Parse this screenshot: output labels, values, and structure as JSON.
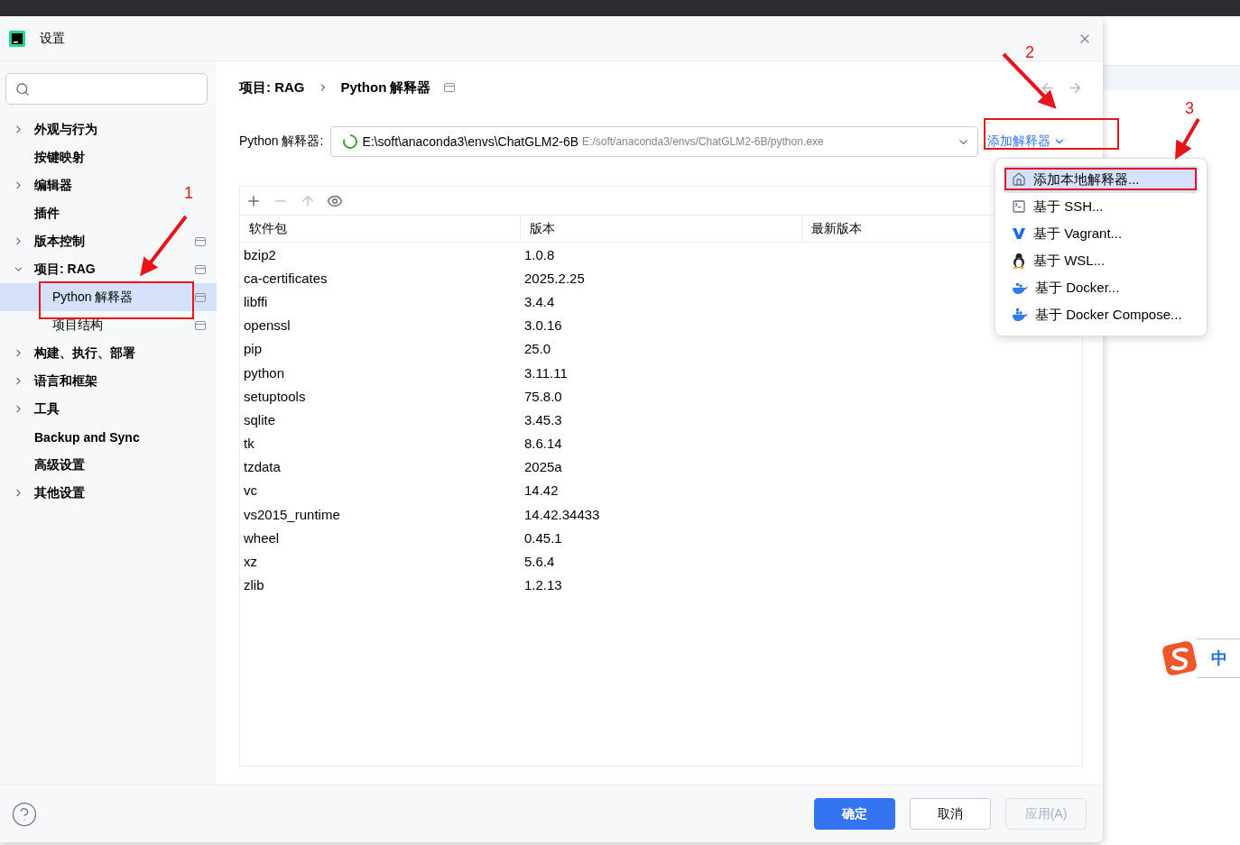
{
  "dialog": {
    "title": "设置"
  },
  "sidebar": {
    "items": [
      {
        "label": "外观与行为",
        "expanded": false,
        "selected": false
      },
      {
        "label": "按键映射",
        "selected": false
      },
      {
        "label": "编辑器",
        "expanded": false,
        "selected": false
      },
      {
        "label": "插件",
        "selected": false
      },
      {
        "label": "版本控制",
        "expanded": false,
        "selected": false,
        "scoped": true
      },
      {
        "label": "项目: RAG",
        "expanded": true,
        "selected": false,
        "scoped": true,
        "children": [
          {
            "label": "Python 解释器",
            "selected": true,
            "scoped": true
          },
          {
            "label": "项目结构",
            "selected": false,
            "scoped": true
          }
        ]
      },
      {
        "label": "构建、执行、部署",
        "expanded": false,
        "selected": false
      },
      {
        "label": "语言和框架",
        "expanded": false,
        "selected": false
      },
      {
        "label": "工具",
        "expanded": false,
        "selected": false
      },
      {
        "label": "Backup and Sync",
        "selected": false
      },
      {
        "label": "高级设置",
        "selected": false
      },
      {
        "label": "其他设置",
        "expanded": false,
        "selected": false
      }
    ]
  },
  "breadcrumb": [
    "项目: RAG",
    "Python 解释器"
  ],
  "interpreter": {
    "label": "Python 解释器:",
    "name": "E:\\soft\\anaconda3\\envs\\ChatGLM2-6B",
    "path": "E:/soft/anaconda3/envs/ChatGLM2-6B/python.exe",
    "add_link": "添加解释器"
  },
  "table": {
    "columns": [
      "软件包",
      "版本",
      "最新版本"
    ],
    "rows": [
      [
        "bzip2",
        "1.0.8",
        ""
      ],
      [
        "ca-certificates",
        "2025.2.25",
        ""
      ],
      [
        "libffi",
        "3.4.4",
        ""
      ],
      [
        "openssl",
        "3.0.16",
        ""
      ],
      [
        "pip",
        "25.0",
        ""
      ],
      [
        "python",
        "3.11.11",
        ""
      ],
      [
        "setuptools",
        "75.8.0",
        ""
      ],
      [
        "sqlite",
        "3.45.3",
        ""
      ],
      [
        "tk",
        "8.6.14",
        ""
      ],
      [
        "tzdata",
        "2025a",
        ""
      ],
      [
        "vc",
        "14.42",
        ""
      ],
      [
        "vs2015_runtime",
        "14.42.34433",
        ""
      ],
      [
        "wheel",
        "0.45.1",
        ""
      ],
      [
        "xz",
        "5.6.4",
        ""
      ],
      [
        "zlib",
        "1.2.13",
        ""
      ]
    ]
  },
  "add_menu": [
    {
      "kind": "home",
      "label": "添加本地解释器...",
      "selected": true
    },
    {
      "kind": "terminal",
      "label": "基于 SSH...",
      "selected": false
    },
    {
      "kind": "vagrant",
      "label": "基于 Vagrant...",
      "selected": false
    },
    {
      "kind": "linux",
      "label": "基于 WSL...",
      "selected": false
    },
    {
      "kind": "docker",
      "label": "基于 Docker...",
      "selected": false
    },
    {
      "kind": "compose",
      "label": "基于 Docker Compose...",
      "selected": false
    }
  ],
  "buttons": [
    {
      "label": "确定",
      "kind": "primary"
    },
    {
      "label": "取消",
      "kind": "default"
    },
    {
      "label": "应用(A)",
      "kind": "default",
      "disabled": true
    }
  ],
  "ime": {
    "label": "中"
  },
  "annotations": [
    {
      "label": "1"
    },
    {
      "label": "2"
    },
    {
      "label": "3"
    }
  ]
}
